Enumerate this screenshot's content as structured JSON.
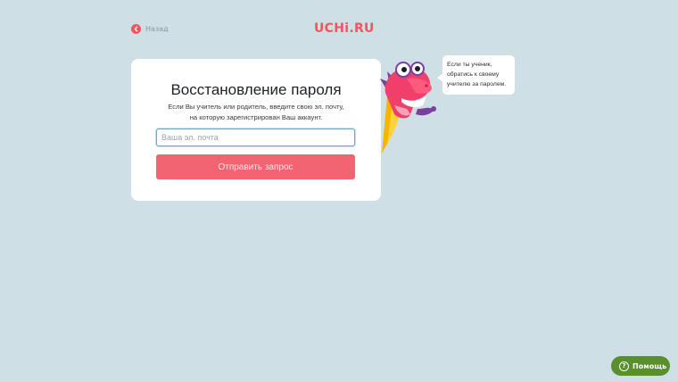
{
  "header": {
    "back_label": "Назад",
    "logo_text": "UCHi.RU",
    "brand_color": "#f25560"
  },
  "form": {
    "title": "Восстановление пароля",
    "description_line1": "Если Вы учитель или родитель, введите свою эл. почту,",
    "description_line2": "на которую зарегистрирован Ваш аккаунт.",
    "email_value": "",
    "email_placeholder": "Ваша эл. почта",
    "submit_label": "Отправить запрос",
    "submit_color": "#f26471"
  },
  "bubble": {
    "line1": "Если ты ученик,",
    "line2": "обратись к своему",
    "line3": "учителю за паролем."
  },
  "help": {
    "label": "Помощь",
    "icon": "question-icon",
    "color": "#5a8f2e"
  }
}
